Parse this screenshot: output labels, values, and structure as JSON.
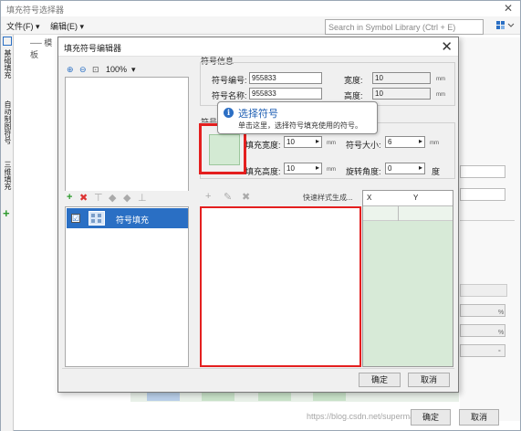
{
  "outer_window": {
    "title": "填充符号选择器",
    "close_glyph": "✕",
    "menu": {
      "file": "文件(F) ▾",
      "edit": "编辑(E) ▾"
    },
    "search_placeholder": "Search in Symbol Library (Ctrl + E)",
    "search_icon": "search-icon",
    "left_tabs": [
      "基础填充",
      "自动制图符号",
      "三维填充"
    ],
    "add_glyph": "+",
    "tree_label": "── 模板",
    "buttons": {
      "ok": "确定",
      "cancel": "取消"
    },
    "units": [
      "%",
      "%",
      "°"
    ]
  },
  "watermark": "https://blog.csdn.net/supermapsupport",
  "dialog": {
    "title": "填充符号编辑器",
    "close_glyph": "✕",
    "zoom": {
      "zoom_in": "⊕",
      "zoom_out": "⊖",
      "fit": "⊡",
      "value": "100%",
      "dropdown": "▾"
    },
    "layer_toolbar": {
      "add": "+",
      "delete": "✖",
      "up": "⊤",
      "move_up": "◆",
      "move_down": "◆",
      "down": "⊥"
    },
    "layer": {
      "checked": "☑",
      "label": "符号填充"
    },
    "symbol_info": {
      "group_title": "符号信息",
      "code_label": "符号编号:",
      "code_value": "955833",
      "name_label": "符号名称:",
      "name_value": "955833",
      "width_label": "宽度:",
      "width_value": "10",
      "height_label": "高度:",
      "height_value": "10",
      "unit": "mm"
    },
    "symbol_group_title": "符号",
    "tooltip": {
      "title": "选择符号",
      "desc": "单击这里，选择符号填充使用的符号。"
    },
    "fill_params": {
      "fill_width_label": "填充宽度:",
      "fill_width_value": "10",
      "fill_height_label": "填充高度:",
      "fill_height_value": "10",
      "symbol_size_label": "符号大小:",
      "symbol_size_value": "6",
      "rotation_label": "旋转角度:",
      "rotation_value": "0",
      "unit": "mm",
      "degree": "度",
      "arrow": "▸"
    },
    "style_toolbar": {
      "add": "+",
      "edit": "✎",
      "delete": "✖",
      "quick_generate": "快速样式生成..."
    },
    "coord_table": {
      "col_x": "X",
      "col_y": "Y"
    },
    "buttons": {
      "ok": "确定",
      "cancel": "取消"
    }
  },
  "colors": {
    "accent_blue": "#2a6fc4",
    "highlight_red": "#e41f1f",
    "symbol_fill": "#d3ead3"
  }
}
